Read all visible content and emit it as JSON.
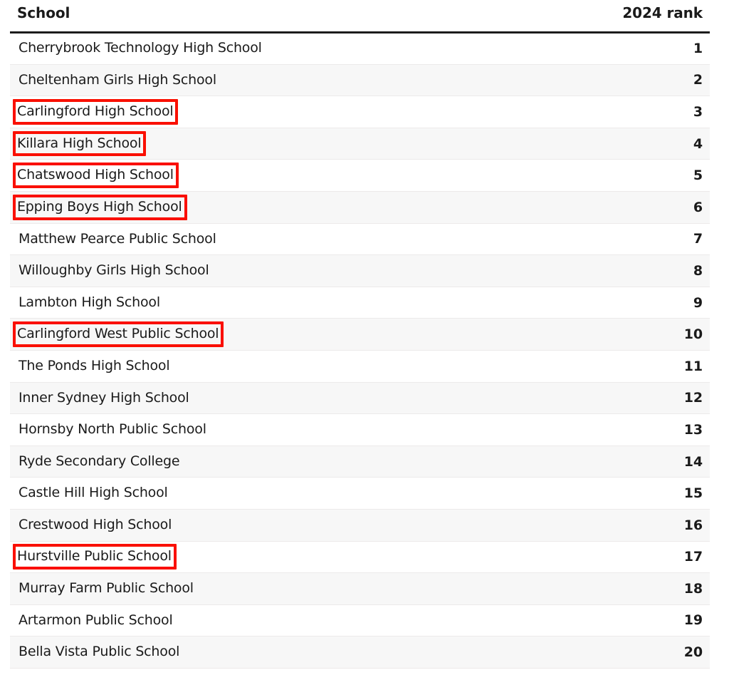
{
  "table": {
    "headers": {
      "school": "School",
      "rank": "2024 rank"
    },
    "highlight_color": "#fa0f00",
    "rows": [
      {
        "school": "Cherrybrook Technology High School",
        "rank": "1",
        "highlighted": false
      },
      {
        "school": "Cheltenham Girls High School",
        "rank": "2",
        "highlighted": false
      },
      {
        "school": "Carlingford High School",
        "rank": "3",
        "highlighted": true
      },
      {
        "school": "Killara High School",
        "rank": "4",
        "highlighted": true
      },
      {
        "school": "Chatswood High School",
        "rank": "5",
        "highlighted": true
      },
      {
        "school": "Epping Boys High School",
        "rank": "6",
        "highlighted": true
      },
      {
        "school": "Matthew Pearce Public School",
        "rank": "7",
        "highlighted": false
      },
      {
        "school": "Willoughby Girls High School",
        "rank": "8",
        "highlighted": false
      },
      {
        "school": "Lambton High School",
        "rank": "9",
        "highlighted": false
      },
      {
        "school": "Carlingford West Public School",
        "rank": "10",
        "highlighted": true
      },
      {
        "school": "The Ponds High School",
        "rank": "11",
        "highlighted": false
      },
      {
        "school": "Inner Sydney High School",
        "rank": "12",
        "highlighted": false
      },
      {
        "school": "Hornsby North Public School",
        "rank": "13",
        "highlighted": false
      },
      {
        "school": "Ryde Secondary College",
        "rank": "14",
        "highlighted": false
      },
      {
        "school": "Castle Hill High School",
        "rank": "15",
        "highlighted": false
      },
      {
        "school": "Crestwood High School",
        "rank": "16",
        "highlighted": false
      },
      {
        "school": "Hurstville Public School",
        "rank": "17",
        "highlighted": true
      },
      {
        "school": "Murray Farm Public School",
        "rank": "18",
        "highlighted": false
      },
      {
        "school": "Artarmon Public School",
        "rank": "19",
        "highlighted": false
      },
      {
        "school": "Bella Vista Public School",
        "rank": "20",
        "highlighted": false
      }
    ]
  }
}
